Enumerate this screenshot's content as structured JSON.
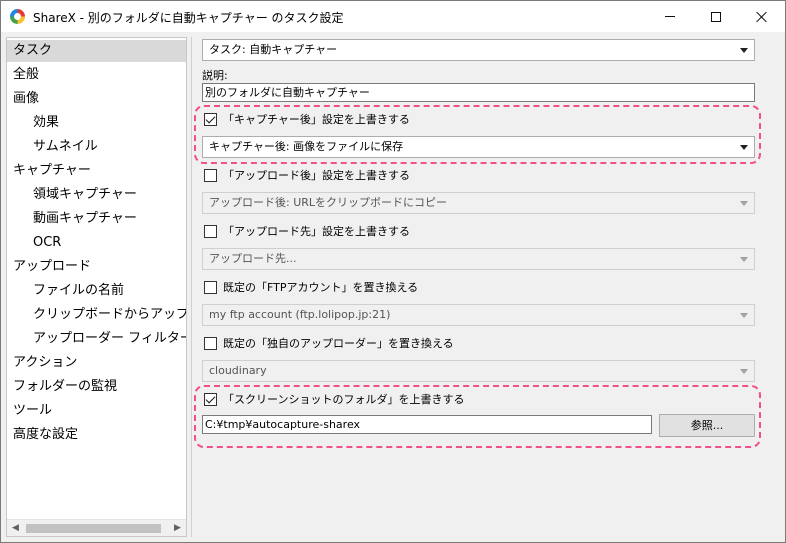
{
  "window": {
    "title": "ShareX - 別のフォルダに自動キャプチャー のタスク設定",
    "icon": "sharex-app-icon"
  },
  "sidebar": {
    "items": [
      {
        "label": "タスク",
        "selected": true
      },
      {
        "label": "全般"
      },
      {
        "label": "画像"
      },
      {
        "label": "効果"
      },
      {
        "label": "サムネイル"
      },
      {
        "label": "キャプチャー"
      },
      {
        "label": "領域キャプチャー"
      },
      {
        "label": "動画キャプチャー"
      },
      {
        "label": "OCR"
      },
      {
        "label": "アップロード"
      },
      {
        "label": "ファイルの名前"
      },
      {
        "label": "クリップボードからアップロー"
      },
      {
        "label": "アップローダー フィルター:"
      },
      {
        "label": "アクション"
      },
      {
        "label": "フォルダーの監視"
      },
      {
        "label": "ツール"
      },
      {
        "label": "高度な設定"
      }
    ],
    "scroll_left_icon": "◀",
    "scroll_right_icon": "▶"
  },
  "task": {
    "combo_value": "タスク: 自動キャプチャー",
    "description_label": "説明:",
    "description_value": "別のフォルダに自動キャプチャー"
  },
  "after_capture": {
    "checkbox_label": "「キャプチャー後」設定を上書きする",
    "checked": true,
    "combo_value": "キャプチャー後: 画像をファイルに保存"
  },
  "after_upload": {
    "checkbox_label": "「アップロード後」設定を上書きする",
    "checked": false,
    "combo_value": "アップロード後: URLをクリップボードにコピー"
  },
  "upload_dest": {
    "checkbox_label": "「アップロード先」設定を上書きする",
    "checked": false,
    "combo_value": "アップロード先..."
  },
  "ftp": {
    "checkbox_label": "既定の「FTPアカウント」を置き換える",
    "checked": false,
    "combo_value": "my ftp account (ftp.lolipop.jp:21)"
  },
  "custom_uploader": {
    "checkbox_label": "既定の「独自のアップローダー」を置き換える",
    "checked": false,
    "combo_value": "cloudinary"
  },
  "screenshot_folder": {
    "checkbox_label": "「スクリーンショットのフォルダ」を上書きする",
    "checked": true,
    "path_value": "C:¥tmp¥autocapture-sharex",
    "browse_label": "参照..."
  },
  "colors": {
    "highlight": "#f0508c",
    "selected_bg": "#d9d9d9",
    "window_bg": "#f0f0f0"
  }
}
